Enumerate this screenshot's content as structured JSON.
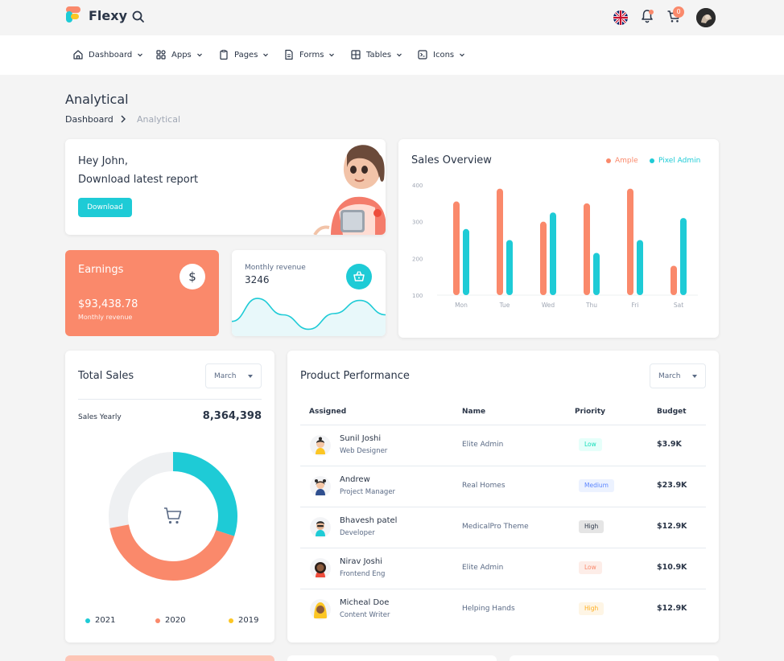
{
  "app": {
    "name": "Flexy"
  },
  "header": {
    "cart_count": "0"
  },
  "nav": [
    {
      "label": "Dashboard",
      "icon": "home-icon"
    },
    {
      "label": "Apps",
      "icon": "apps-icon"
    },
    {
      "label": "Pages",
      "icon": "clipboard-icon"
    },
    {
      "label": "Forms",
      "icon": "file-icon"
    },
    {
      "label": "Tables",
      "icon": "table-icon"
    },
    {
      "label": "Icons",
      "icon": "terminal-icon"
    }
  ],
  "page": {
    "title": "Analytical",
    "breadcrumb": [
      "Dashboard",
      "Analytical"
    ]
  },
  "welcome": {
    "line1": "Hey John,",
    "line2": "Download latest report",
    "button": "Download"
  },
  "earnings": {
    "title": "Earnings",
    "amount": "$93,438.78",
    "subtitle": "Monthly revenue"
  },
  "monthly_revenue": {
    "title": "Monthly revenue",
    "value": "3246"
  },
  "sales_overview": {
    "title": "Sales Overview"
  },
  "total_sales": {
    "title": "Total Sales",
    "select": "March",
    "yearly_label": "Sales Yearly",
    "yearly_value": "8,364,398",
    "legend": [
      "2021",
      "2020",
      "2019"
    ]
  },
  "product_performance": {
    "title": "Product Performance",
    "select": "March",
    "columns": [
      "Assigned",
      "Name",
      "Priority",
      "Budget"
    ],
    "rows": [
      {
        "name": "Sunil Joshi",
        "role": "Web Designer",
        "project": "Elite Admin",
        "priority": "Low",
        "budget": "$3.9K"
      },
      {
        "name": "Andrew",
        "role": "Project Manager",
        "project": "Real Homes",
        "priority": "Medium",
        "budget": "$23.9K"
      },
      {
        "name": "Bhavesh patel",
        "role": "Developer",
        "project": "MedicalPro Theme",
        "priority": "High",
        "budget": "$12.9K"
      },
      {
        "name": "Nirav Joshi",
        "role": "Frontend Eng",
        "project": "Elite Admin",
        "priority": "Low",
        "budget": "$10.9K"
      },
      {
        "name": "Micheal Doe",
        "role": "Content Writer",
        "project": "Helping Hands",
        "priority": "High",
        "budget": "$12.9K"
      }
    ]
  },
  "colors": {
    "primary": "#1ecbd6",
    "secondary": "#fa896b",
    "warning": "#fcc624",
    "donut_bg": "#eef0f2"
  },
  "chart_data": [
    {
      "type": "bar",
      "categories": [
        "Mon",
        "Tue",
        "Wed",
        "Thu",
        "Fri",
        "Sat"
      ],
      "series": [
        {
          "name": "Ample",
          "color": "#fa896b",
          "values": [
            355,
            390,
            300,
            350,
            390,
            180
          ]
        },
        {
          "name": "Pixel Admin",
          "color": "#1ecbd6",
          "values": [
            280,
            250,
            325,
            215,
            250,
            310
          ]
        }
      ],
      "y_ticks": [
        "400",
        "300",
        "200",
        "100"
      ],
      "ylim": [
        100,
        400
      ],
      "legend": "top-right",
      "grid": false
    },
    {
      "type": "pie",
      "variant": "donut",
      "labels": [
        "2021",
        "2020",
        "2019"
      ],
      "values": [
        30,
        42,
        28
      ],
      "colors": [
        "#1ecbd6",
        "#fa896b",
        "#eef0f2"
      ]
    },
    {
      "type": "area",
      "title": "Monthly revenue",
      "values": [
        20,
        55,
        30,
        8,
        32,
        52,
        30
      ]
    }
  ]
}
